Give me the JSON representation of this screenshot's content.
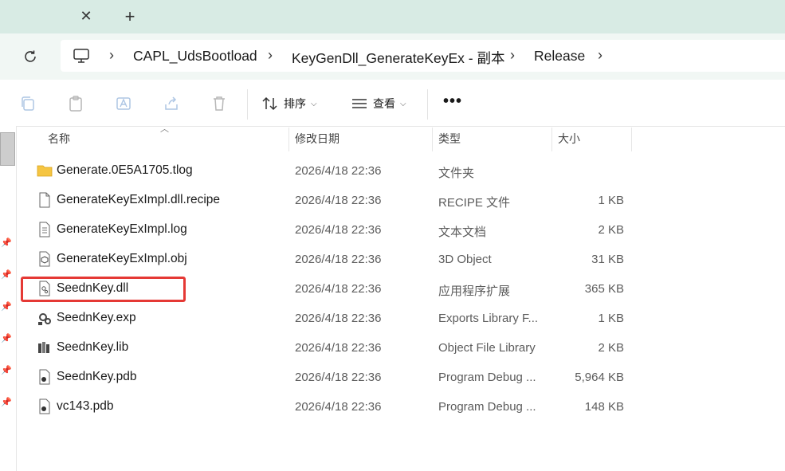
{
  "tabbar": {
    "close_icon": "close-icon",
    "new_tab_icon": "plus-icon"
  },
  "address": {
    "breadcrumbs": [
      "CAPL_UdsBootload",
      "KeyGenDll_GenerateKeyEx - 副本",
      "Release"
    ]
  },
  "toolbar": {
    "sort_label": "排序",
    "view_label": "查看",
    "more_label": "•••"
  },
  "columns": {
    "name": "名称",
    "date": "修改日期",
    "type": "类型",
    "size": "大小"
  },
  "files": [
    {
      "name": "Generate.0E5A1705.tlog",
      "date": "2026/4/18 22:36",
      "type": "文件夹",
      "size": "",
      "icon": "folder-icon"
    },
    {
      "name": "GenerateKeyExImpl.dll.recipe",
      "date": "2026/4/18 22:36",
      "type": "RECIPE 文件",
      "size": "1 KB",
      "icon": "file-icon"
    },
    {
      "name": "GenerateKeyExImpl.log",
      "date": "2026/4/18 22:36",
      "type": "文本文档",
      "size": "2 KB",
      "icon": "text-file-icon"
    },
    {
      "name": "GenerateKeyExImpl.obj",
      "date": "2026/4/18 22:36",
      "type": "3D Object",
      "size": "31 KB",
      "icon": "3d-object-icon"
    },
    {
      "name": "SeednKey.dll",
      "date": "2026/4/18 22:36",
      "type": "应用程序扩展",
      "size": "365 KB",
      "icon": "dll-file-icon"
    },
    {
      "name": "SeednKey.exp",
      "date": "2026/4/18 22:36",
      "type": "Exports Library F...",
      "size": "1 KB",
      "icon": "exp-file-icon"
    },
    {
      "name": "SeednKey.lib",
      "date": "2026/4/18 22:36",
      "type": "Object File Library",
      "size": "2 KB",
      "icon": "lib-file-icon"
    },
    {
      "name": "SeednKey.pdb",
      "date": "2026/4/18 22:36",
      "type": "Program Debug ...",
      "size": "5,964 KB",
      "icon": "pdb-file-icon"
    },
    {
      "name": "vc143.pdb",
      "date": "2026/4/18 22:36",
      "type": "Program Debug ...",
      "size": "148 KB",
      "icon": "pdb-file-icon"
    }
  ],
  "highlight_color": "#e53935",
  "accent_color": "#d8ebe4"
}
